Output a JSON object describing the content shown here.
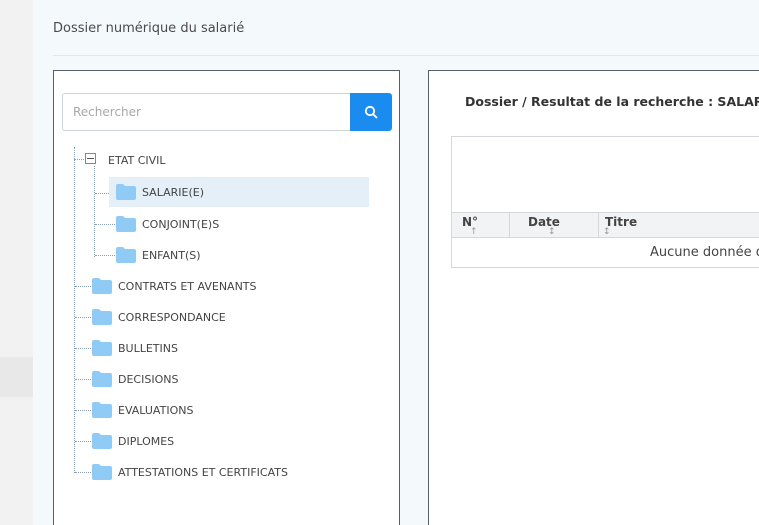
{
  "page": {
    "title": "Dossier numérique du salarié"
  },
  "search": {
    "placeholder": "Rechercher",
    "value": ""
  },
  "tree": {
    "root": {
      "label": "ETAT CIVIL",
      "expanded": true
    },
    "children": [
      {
        "label": "SALARIE(E)",
        "selected": true
      },
      {
        "label": "CONJOINT(E)S"
      },
      {
        "label": "ENFANT(S)"
      }
    ],
    "folders": [
      {
        "label": "CONTRATS ET AVENANTS"
      },
      {
        "label": "CORRESPONDANCE"
      },
      {
        "label": "BULLETINS"
      },
      {
        "label": "DECISIONS"
      },
      {
        "label": "EVALUATIONS"
      },
      {
        "label": "DIPLOMES"
      },
      {
        "label": "ATTESTATIONS ET CERTIFICATS"
      }
    ]
  },
  "results": {
    "title": "Dossier / Resultat de la recherche : SALARIE(E",
    "columns": [
      {
        "label": "N°",
        "sort": "↑"
      },
      {
        "label": "Date",
        "sort": "↕"
      },
      {
        "label": "Titre",
        "sort": "↕"
      }
    ],
    "empty_text": "Aucune donnée d"
  },
  "colors": {
    "accent": "#1a8cf0",
    "folder": "#8fcbf5",
    "selected_row": "#e4eff7",
    "panel_border": "#55606b"
  }
}
